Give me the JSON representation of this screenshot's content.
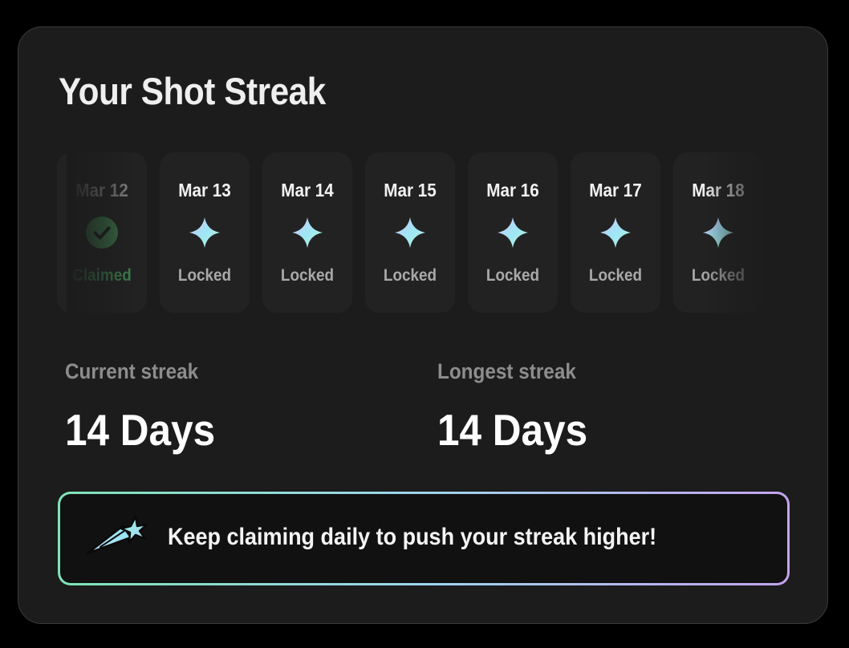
{
  "header": {
    "title": "Your Shot Streak"
  },
  "days": [
    {
      "date": "Mar 12",
      "status": "Claimed",
      "icon": "check-circle-icon"
    },
    {
      "date": "Mar 13",
      "status": "Locked",
      "icon": "sparkle-star-icon"
    },
    {
      "date": "Mar 14",
      "status": "Locked",
      "icon": "sparkle-star-icon"
    },
    {
      "date": "Mar 15",
      "status": "Locked",
      "icon": "sparkle-star-icon"
    },
    {
      "date": "Mar 16",
      "status": "Locked",
      "icon": "sparkle-star-icon"
    },
    {
      "date": "Mar 17",
      "status": "Locked",
      "icon": "sparkle-star-icon"
    },
    {
      "date": "Mar 18",
      "status": "Locked",
      "icon": "sparkle-star-icon"
    }
  ],
  "stats": {
    "current_label": "Current streak",
    "current_value": "14 Days",
    "longest_label": "Longest streak",
    "longest_value": "14 Days"
  },
  "banner": {
    "text": "Keep claiming daily to push your streak higher!",
    "icon": "shooting-star-icon"
  },
  "colors": {
    "background": "#000000",
    "card": "#1c1c1c",
    "day_tile": "#222222",
    "claimed": "#3f8a54",
    "locked_text": "#a9a9a9",
    "gradient_start": "#7fe3b6",
    "gradient_end": "#c4a3ee"
  }
}
